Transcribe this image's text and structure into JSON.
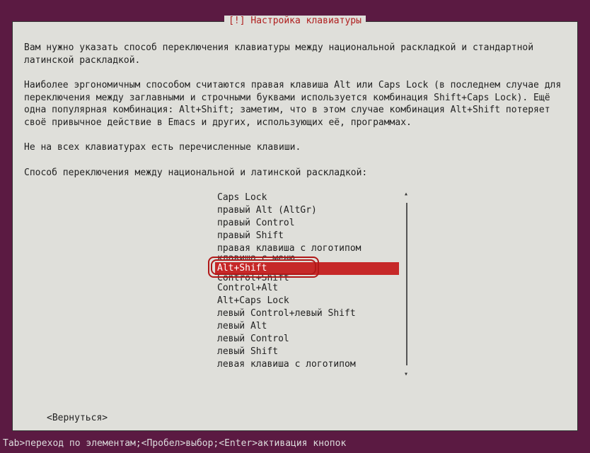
{
  "dialog": {
    "title": "[!] Настройка клавиатуры",
    "para1": "Вам нужно указать способ переключения клавиатуры между национальной раскладкой и стандартной латинской раскладкой.",
    "para2": "Наиболее эргономичным способом считаются правая клавиша Alt или Caps Lock (в последнем случае для переключения между заглавными и строчными буквами используется комбинация Shift+Caps Lock). Ещё одна популярная комбинация: Alt+Shift; заметим, что в этом случае комбинация Alt+Shift потеряет своё привычное действие в Emacs и других, использующих её, программах.",
    "para3": "Не на всех клавиатурах есть перечисленные клавиши.",
    "prompt": "Способ переключения между национальной и латинской раскладкой:",
    "back_label": "<Вернуться>"
  },
  "list": {
    "items": [
      "Caps Lock",
      "правый Alt (AltGr)",
      "правый Control",
      "правый Shift",
      "правая клавиша с логотипом",
      "клавиша с меню",
      "Alt+Shift",
      "Control+Shift",
      "Control+Alt",
      "Alt+Caps Lock",
      "левый Control+левый Shift",
      "левый Alt",
      "левый Control",
      "левый Shift",
      "левая клавиша с логотипом"
    ],
    "selected_index": 6,
    "scroll_up": "▴",
    "scroll_down": "▾"
  },
  "statusbar": {
    "tab_label": "Tab",
    "tab_text": ">переход по элементам; ",
    "space_label": "<Пробел",
    "space_text": ">выбор; ",
    "enter_label": "<Enter",
    "enter_text": ">активация кнопок"
  }
}
